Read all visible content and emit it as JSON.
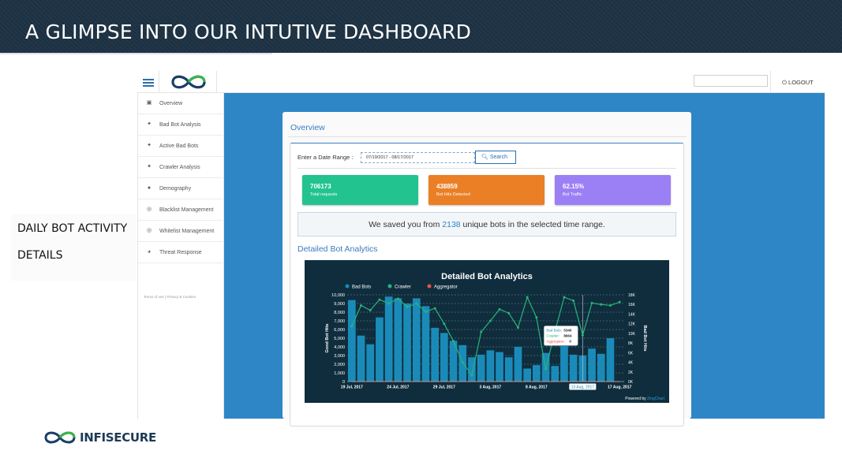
{
  "slide": {
    "title": "A GLIMPSE INTO OUR INTUTIVE DASHBOARD",
    "caption_lines": [
      "DAILY BOT ACTIVITY",
      "DETAILS"
    ],
    "brand_name": "INFISECURE",
    "colors": {
      "banner": "#1d3244",
      "accent_blue": "#2e86c7",
      "logo_green": "#3bb54a"
    }
  },
  "app": {
    "logout_label": "LOGOUT",
    "logout_icon": "power-icon",
    "sidebar": {
      "items": [
        {
          "label": "Overview",
          "icon": "briefcase-icon"
        },
        {
          "label": "Bad Bot Analysis",
          "icon": "bug-icon"
        },
        {
          "label": "Active Bad Bots",
          "icon": "bug-icon"
        },
        {
          "label": "Crawler Analysis",
          "icon": "bug-icon"
        },
        {
          "label": "Demography",
          "icon": "globe-icon"
        },
        {
          "label": "Blacklist Management",
          "icon": "target-icon"
        },
        {
          "label": "Whitelist Management",
          "icon": "target-icon"
        },
        {
          "label": "Threat Response",
          "icon": "bomb-icon"
        }
      ],
      "footer": "Terms of use | Privacy & Cookies"
    },
    "overview": {
      "title": "Overview",
      "date_label": "Enter a Date Range :",
      "date_value": "07/19/2017 - 08/17/2017",
      "search_label": "Search",
      "stats": [
        {
          "value": "706173",
          "label": "Total requests",
          "color": "#22c38e"
        },
        {
          "value": "438859",
          "label": "Bot Hits Detected",
          "color": "#ea7f26"
        },
        {
          "value": "62.15%",
          "label": "Bot Traffic",
          "color": "#9b80f5"
        }
      ],
      "saved": {
        "prefix": "We saved you from ",
        "count": "2138",
        "suffix": " unique bots in the selected time range."
      },
      "detail_heading": "Detailed Bot Analytics"
    }
  },
  "chart_data": {
    "type": "bar",
    "title": "Detailed Bot Analytics",
    "ylabel": "Good Bot Hits",
    "y2label": "Bad Bot Hits",
    "ylim": [
      0,
      10000
    ],
    "y2lim": [
      0,
      18000
    ],
    "yticks": [
      "0",
      "1,000",
      "2,000",
      "3,000",
      "4,000",
      "5,000",
      "6,000",
      "7,000",
      "8,000",
      "9,000",
      "10,000"
    ],
    "y2ticks": [
      "0K",
      "2K",
      "4K",
      "6K",
      "8K",
      "10K",
      "12K",
      "14K",
      "16K",
      "18K"
    ],
    "xticks": [
      {
        "index": 0,
        "label": "19 Jul, 2017"
      },
      {
        "index": 5,
        "label": "24 Jul, 2017"
      },
      {
        "index": 10,
        "label": "29 Jul, 2017"
      },
      {
        "index": 15,
        "label": "3 Aug, 2017"
      },
      {
        "index": 20,
        "label": "8 Aug, 2017"
      },
      {
        "index": 25,
        "label": "13 Aug, 2017"
      },
      {
        "index": 29,
        "label": "17 Aug, 2017"
      }
    ],
    "legend": [
      "Bad Bots",
      "Crawler",
      "Aggregator"
    ],
    "legend_position": "top-center",
    "series": [
      {
        "name": "Bad Bots",
        "color": "#1a8bb8",
        "axis": "left",
        "values": [
          9400,
          5300,
          4300,
          7400,
          9800,
          9600,
          9000,
          9600,
          8700,
          6200,
          5600,
          4700,
          4200,
          2800,
          3100,
          3600,
          3400,
          2800,
          4000,
          1500,
          1900,
          3300,
          1800,
          4100,
          3100,
          3000,
          3800,
          3200,
          5000,
          0
        ]
      },
      {
        "name": "Crawler",
        "color": "#29b37c",
        "axis": "right",
        "values": [
          11500,
          15800,
          14800,
          17000,
          16200,
          17200,
          15500,
          16200,
          14500,
          15200,
          12000,
          8400,
          4000,
          1300,
          10300,
          12600,
          15000,
          14200,
          11200,
          17500,
          13300,
          2600,
          10400,
          17500,
          16800,
          9600,
          16300,
          16000,
          15800,
          16500
        ]
      },
      {
        "name": "Aggregator",
        "color": "#e8524a",
        "axis": "left",
        "values": [
          0,
          0,
          0,
          0,
          0,
          0,
          0,
          0,
          0,
          0,
          0,
          0,
          0,
          0,
          0,
          0,
          0,
          0,
          0,
          0,
          0,
          0,
          0,
          0,
          0,
          0,
          0,
          0,
          0,
          0
        ]
      }
    ],
    "tooltip": {
      "index": 25,
      "bad_bots_label": "Bad Bots:",
      "bad_bots": "5340",
      "crawler_label": "Crawler:",
      "crawler": "8664",
      "aggregator_label": "Aggregator:",
      "aggregator": "0"
    },
    "credit_prefix": "Powered by ",
    "credit_name": "ZingChart",
    "grid": true
  }
}
